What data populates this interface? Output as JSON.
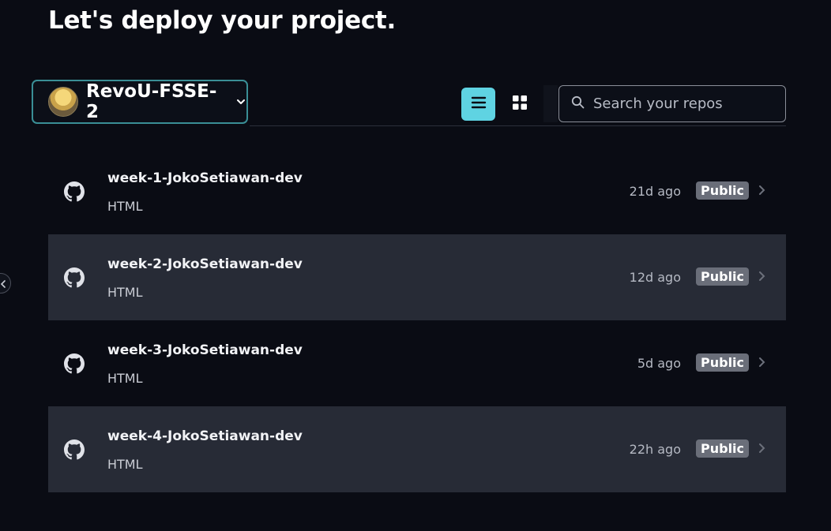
{
  "header": {
    "title": "Let's deploy your project."
  },
  "account": {
    "name": "RevoU-FSSE-2"
  },
  "search": {
    "placeholder": "Search your repos",
    "value": ""
  },
  "colors": {
    "accent": "#5fd3e2",
    "selector_border": "#3a8f96",
    "row_alt": "#272b36",
    "badge": "#6a6e79"
  },
  "repos": [
    {
      "name": "week-1-JokoSetiawan-dev",
      "language": "HTML",
      "updated": "21d ago",
      "visibility": "Public"
    },
    {
      "name": "week-2-JokoSetiawan-dev",
      "language": "HTML",
      "updated": "12d ago",
      "visibility": "Public"
    },
    {
      "name": "week-3-JokoSetiawan-dev",
      "language": "HTML",
      "updated": "5d ago",
      "visibility": "Public"
    },
    {
      "name": "week-4-JokoSetiawan-dev",
      "language": "HTML",
      "updated": "22h ago",
      "visibility": "Public"
    }
  ]
}
